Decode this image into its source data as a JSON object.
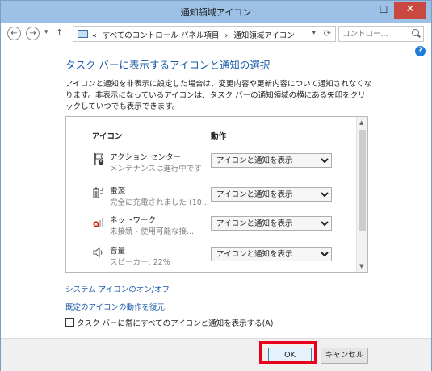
{
  "window": {
    "title": "通知領域アイコン",
    "controls": {
      "minimize": "—",
      "maximize": "☐",
      "close": "✕"
    }
  },
  "nav": {
    "back": "←",
    "forward": "→",
    "recent": "▾",
    "up": "↑",
    "breadcrumb_prefix": "«",
    "breadcrumbs": [
      "すべてのコントロール パネル項目",
      "›",
      "通知領域アイコン"
    ],
    "dropdown": "▾",
    "refresh": "⟳",
    "search_placeholder": "コントロー..."
  },
  "help": "?",
  "content": {
    "heading": "タスク バーに表示するアイコンと通知の選択",
    "description": "アイコンと通知を非表示に設定した場合は、変更内容や更新内容について通知されなくなります。非表示になっているアイコンは、タスク バーの通知領域の横にある矢印をクリックしていつでも表示できます。",
    "columns": {
      "icon": "アイコン",
      "action": "動作"
    },
    "rows": [
      {
        "name": "アクション センター",
        "sub": "メンテナンスは進行中です",
        "value": "アイコンと通知を表示",
        "icon": "action-center-flag-icon"
      },
      {
        "name": "電源",
        "sub": "完全に充電されました (10...",
        "value": "アイコンと通知を表示",
        "icon": "battery-icon"
      },
      {
        "name": "ネットワーク",
        "sub": "未接続 - 使用可能な接...",
        "value": "アイコンと通知を表示",
        "icon": "network-icon"
      },
      {
        "name": "音量",
        "sub": "スピーカー: 22%",
        "value": "アイコンと通知を表示",
        "icon": "speaker-icon"
      }
    ],
    "links": {
      "system_icons": "システム アイコンのオン/オフ",
      "restore_default": "既定のアイコンの動作を復元"
    },
    "checkbox": {
      "label": "タスク バーに常にすべてのアイコンと通知を表示する(A)",
      "checked": false
    }
  },
  "footer": {
    "ok": "OK",
    "cancel": "キャンセル"
  }
}
